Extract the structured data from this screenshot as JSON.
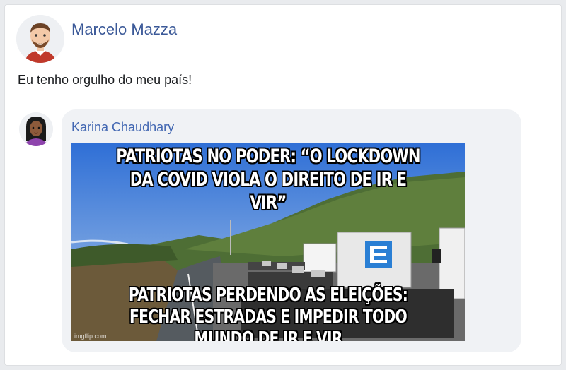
{
  "post": {
    "author_name": "Marcelo Mazza",
    "text": "Eu tenho orgulho do meu país!"
  },
  "comment": {
    "author_name": "Karina Chaudhary",
    "meme": {
      "top_text": "PATRIOTAS NO PODER: “O LOCKDOWN DA COVID VIOLA O DIREITO DE IR E VIR”",
      "bottom_text": "PATRIOTAS PERDENDO AS ELEIÇÕES: FECHAR ESTRADAS E IMPEDIR TODO MUNDO DE IR E VIR",
      "watermark": "imgflip.com"
    }
  },
  "colors": {
    "name_link": "#3b5998",
    "comment_bubble": "#f0f2f5",
    "page_background": "#e9ebee"
  }
}
